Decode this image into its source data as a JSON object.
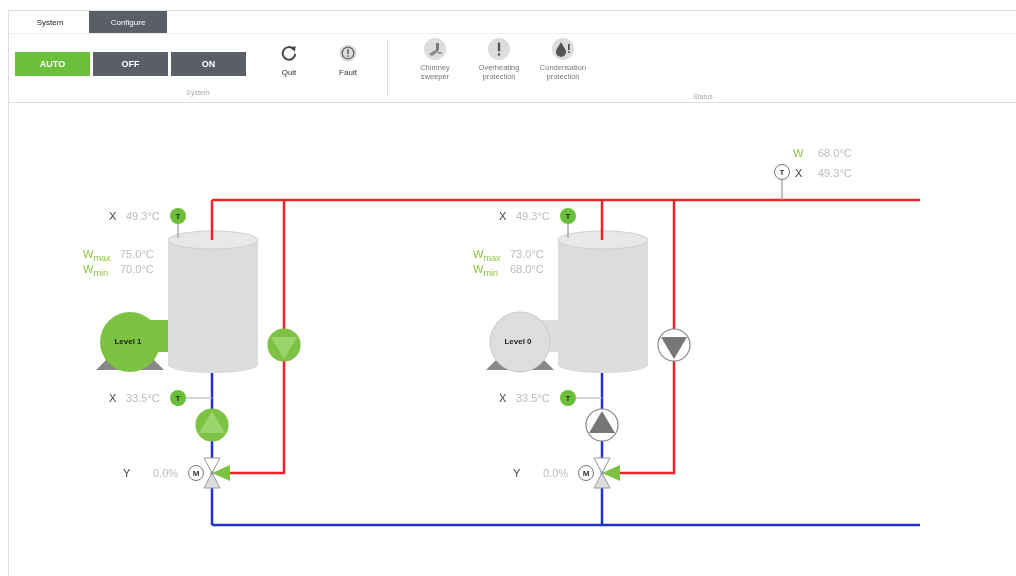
{
  "tabs": [
    {
      "label": "System",
      "selected": true
    },
    {
      "label": "Configure",
      "selected": false
    }
  ],
  "modes": [
    {
      "label": "AUTO",
      "selected": true
    },
    {
      "label": "OFF",
      "selected": false
    },
    {
      "label": "ON",
      "selected": false
    }
  ],
  "actions": [
    {
      "label": "Quit",
      "kind": "reset"
    },
    {
      "label": "Fault",
      "kind": "fault"
    }
  ],
  "system_group_label": "System",
  "status_items": [
    {
      "label": "Chimney sweeper",
      "kind": "chimney"
    },
    {
      "label": "Overheating protection",
      "kind": "overheat"
    },
    {
      "label": "Condensation protection",
      "kind": "condensation"
    }
  ],
  "status_group_label": "Status",
  "outdoor": {
    "w_label": "W",
    "w_value": "68.0°C",
    "sensor": "T",
    "x_label": "X",
    "x_value": "49.3°C"
  },
  "units": [
    {
      "top_sensor": {
        "label": "X",
        "value": "49.3°C",
        "sensor": "T"
      },
      "w_max": {
        "label": "W$_{max}$",
        "value": "75.0°C"
      },
      "w_min": {
        "label": "W$_{min}$",
        "value": "70.0°C"
      },
      "burner": {
        "label": "Level 1",
        "on": true
      },
      "load_pump_on": true,
      "bottom_sensor": {
        "label": "X",
        "value": "33.5°C",
        "sensor": "T"
      },
      "mixing_pump_on": true,
      "valve": {
        "label": "Y",
        "value": "0.0%",
        "motor": "M"
      }
    },
    {
      "top_sensor": {
        "label": "X",
        "value": "49.3°C",
        "sensor": "T"
      },
      "w_max": {
        "label": "W$_{max}$",
        "value": "73.0°C"
      },
      "w_min": {
        "label": "W$_{min}$",
        "value": "68.0°C"
      },
      "burner": {
        "label": "Level 0",
        "on": false
      },
      "load_pump_on": false,
      "bottom_sensor": {
        "label": "X",
        "value": "33.5°C",
        "sensor": "T"
      },
      "mixing_pump_on": false,
      "valve": {
        "label": "Y",
        "value": "0.0%",
        "motor": "M"
      }
    }
  ]
}
